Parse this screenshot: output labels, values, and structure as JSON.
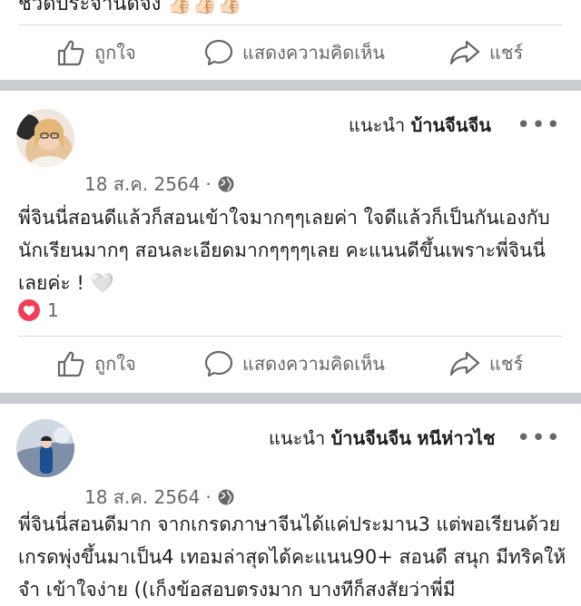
{
  "top_post": {
    "partial_text": "ชวดับระจานดจัง",
    "emojis": "👍🏻👍🏻👍🏻"
  },
  "actions": {
    "like": "ถูกใจ",
    "comment": "แสดงความคิดเห็น",
    "share": "แชร์"
  },
  "posts": [
    {
      "recommend_prefix": "แนะนำ",
      "page_name": "บ้านจีนจีน",
      "extra_name": "",
      "date": "18 ส.ค. 2564",
      "dot": "·",
      "text": "พี่จินนี่สอนดีแล้วก็สอนเข้าใจมากๆๆเลยค่า ใจดีแล้วก็เป็นกันเองกับนักเรียนมากๆ สอนละเอียดมากๆๆๆๆเลย คะแนนดีขึ้นเพราะพี่จินนี่เลยค่ะ ! 🤍",
      "reaction_count": "1"
    },
    {
      "recommend_prefix": "แนะนำ",
      "page_name": "บ้านจีนจีน",
      "extra_name": "หนีห่าวไช",
      "date": "18 ส.ค. 2564",
      "dot": "·",
      "text": "พี่จินนี่สอนดีมาก จากเกรดภาษาจีนได้แค่ประมาน3 แต่พอเรียนด้วย เกรดพุ่งขึ้นมาเป็น4 เทอมล่าสุดได้คะแนน90+ สอนดี สนุก มีทริคให้จำ เข้าใจง่าย ((เก็งข้อสอบตรงมาก บางทีก็สงสัยว่าพี่มี"
    }
  ],
  "colors": {
    "separator": "#c9ccd1",
    "muted": "#65676b",
    "love": "#f33e58"
  }
}
